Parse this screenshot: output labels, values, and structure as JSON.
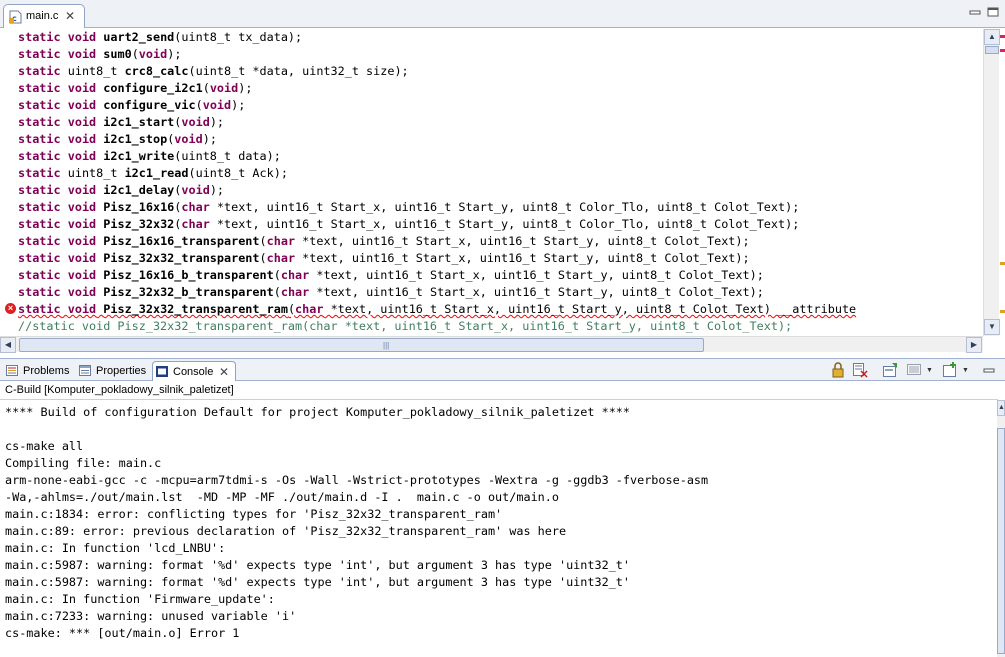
{
  "editor": {
    "tab_label": "main.c",
    "tab_close": "✕",
    "code_lines": [
      {
        "kw1": "static",
        "kw2": "void",
        "plain1": "",
        "fn": "uart2_send",
        "rest": "(uint8_t tx_data);",
        "kw3": "",
        "tail": ""
      },
      {
        "kw1": "static",
        "kw2": "void",
        "plain1": "",
        "fn": "sum0",
        "rest": "(",
        "kw3": "void",
        "tail": ");"
      },
      {
        "kw1": "static",
        "kw2": "",
        "plain1": "uint8_t",
        "fn": "crc8_calc",
        "rest": "(uint8_t *data, uint32_t size);",
        "kw3": "",
        "tail": ""
      },
      {
        "kw1": "static",
        "kw2": "void",
        "plain1": "",
        "fn": "configure_i2c1",
        "rest": "(",
        "kw3": "void",
        "tail": ");"
      },
      {
        "kw1": "static",
        "kw2": "void",
        "plain1": "",
        "fn": "configure_vic",
        "rest": "(",
        "kw3": "void",
        "tail": ");"
      },
      {
        "kw1": "static",
        "kw2": "void",
        "plain1": "",
        "fn": "i2c1_start",
        "rest": "(",
        "kw3": "void",
        "tail": ");"
      },
      {
        "kw1": "static",
        "kw2": "void",
        "plain1": "",
        "fn": "i2c1_stop",
        "rest": "(",
        "kw3": "void",
        "tail": ");"
      },
      {
        "kw1": "static",
        "kw2": "void",
        "plain1": "",
        "fn": "i2c1_write",
        "rest": "(uint8_t data);",
        "kw3": "",
        "tail": ""
      },
      {
        "kw1": "static",
        "kw2": "",
        "plain1": "uint8_t",
        "fn": "i2c1_read",
        "rest": "(uint8_t Ack);",
        "kw3": "",
        "tail": ""
      },
      {
        "kw1": "static",
        "kw2": "void",
        "plain1": "",
        "fn": "i2c1_delay",
        "rest": "(",
        "kw3": "void",
        "tail": ");"
      },
      {
        "kw1": "static",
        "kw2": "void",
        "plain1": "",
        "fn": "Pisz_16x16",
        "rest": "(",
        "kw3": "char",
        "tail": " *text, uint16_t Start_x, uint16_t Start_y, uint8_t Color_Tlo, uint8_t Colot_Text);"
      },
      {
        "kw1": "static",
        "kw2": "void",
        "plain1": "",
        "fn": "Pisz_32x32",
        "rest": "(",
        "kw3": "char",
        "tail": " *text, uint16_t Start_x, uint16_t Start_y, uint8_t Color_Tlo, uint8_t Colot_Text);"
      },
      {
        "kw1": "static",
        "kw2": "void",
        "plain1": "",
        "fn": "Pisz_16x16_transparent",
        "rest": "(",
        "kw3": "char",
        "tail": " *text, uint16_t Start_x, uint16_t Start_y, uint8_t Colot_Text);"
      },
      {
        "kw1": "static",
        "kw2": "void",
        "plain1": "",
        "fn": "Pisz_32x32_transparent",
        "rest": "(",
        "kw3": "char",
        "tail": " *text, uint16_t Start_x, uint16_t Start_y, uint8_t Colot_Text);"
      },
      {
        "kw1": "static",
        "kw2": "void",
        "plain1": "",
        "fn": "Pisz_16x16_b_transparent",
        "rest": "(",
        "kw3": "char",
        "tail": " *text, uint16_t Start_x, uint16_t Start_y, uint8_t Colot_Text);"
      },
      {
        "kw1": "static",
        "kw2": "void",
        "plain1": "",
        "fn": "Pisz_32x32_b_transparent",
        "rest": "(",
        "kw3": "char",
        "tail": " *text, uint16_t Start_x, uint16_t Start_y, uint8_t Colot_Text);"
      },
      {
        "kw1": "static",
        "kw2": "void",
        "plain1": "",
        "fn": "Pisz_32x32_transparent_ram",
        "rest": "(",
        "kw3": "char",
        "tail": " *text, uint16_t Start_x, uint16_t Start_y, uint8_t Colot_Text) __attribute"
      }
    ],
    "comment_line": "//static void Pisz_32x32_transparent_ram(char *text, uint16_t Start_x, uint16_t Start_y, uint8_t Colot_Text);",
    "hscroll_grip": "|||"
  },
  "panel": {
    "tabs": [
      {
        "label": "Problems",
        "icon": "problems-icon"
      },
      {
        "label": "Properties",
        "icon": "properties-icon"
      },
      {
        "label": "Console",
        "icon": "console-icon"
      }
    ],
    "console_close": "✕",
    "console_description": "C-Build [Komputer_pokladowy_silnik_paletizet]",
    "console_lines": [
      "**** Build of configuration Default for project Komputer_pokladowy_silnik_paletizet ****",
      "",
      "cs-make all",
      "Compiling file: main.c",
      "arm-none-eabi-gcc -c -mcpu=arm7tdmi-s -Os -Wall -Wstrict-prototypes -Wextra -g -ggdb3 -fverbose-asm",
      "-Wa,-ahlms=./out/main.lst  -MD -MP -MF ./out/main.d -I .  main.c -o out/main.o",
      "main.c:1834: error: conflicting types for 'Pisz_32x32_transparent_ram'",
      "main.c:89: error: previous declaration of 'Pisz_32x32_transparent_ram' was here",
      "main.c: In function 'lcd_LNBU':",
      "main.c:5987: warning: format '%d' expects type 'int', but argument 3 has type 'uint32_t'",
      "main.c:5987: warning: format '%d' expects type 'int', but argument 3 has type 'uint32_t'",
      "main.c: In function 'Firmware_update':",
      "main.c:7233: warning: unused variable 'i'",
      "cs-make: *** [out/main.o] Error 1"
    ]
  },
  "colors": {
    "keyword": "#7f0055",
    "comment": "#3f7f5f",
    "error": "#ff0000",
    "tab_border": "#8fa3c4"
  }
}
